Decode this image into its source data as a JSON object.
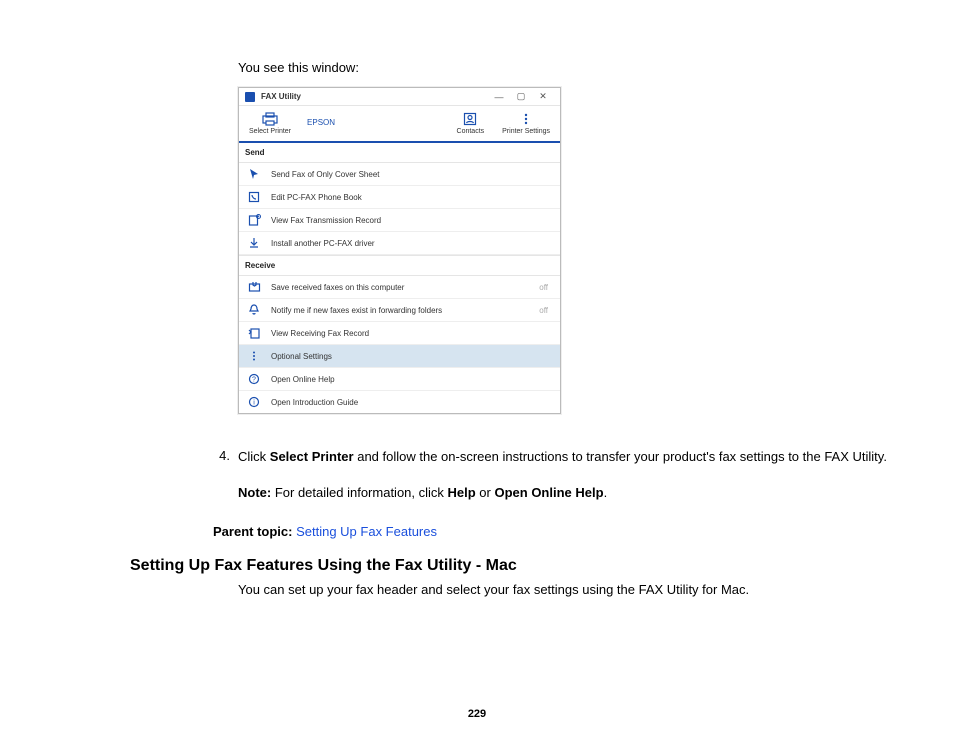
{
  "intro": "You see this window:",
  "window": {
    "title": "FAX Utility",
    "toolbar": {
      "select_printer": "Select Printer",
      "brand": "EPSON",
      "contacts": "Contacts",
      "printer_settings": "Printer Settings"
    },
    "send": {
      "header": "Send",
      "items": [
        "Send Fax of Only Cover Sheet",
        "Edit PC-FAX Phone Book",
        "View Fax Transmission Record",
        "Install another PC-FAX driver"
      ]
    },
    "receive": {
      "header": "Receive",
      "items": [
        {
          "label": "Save received faxes on this computer",
          "status": "off"
        },
        {
          "label": "Notify me if new faxes exist in forwarding folders",
          "status": "off"
        },
        {
          "label": "View Receiving Fax Record",
          "status": ""
        }
      ]
    },
    "footer": {
      "optional_settings": "Optional Settings",
      "online_help": "Open Online Help",
      "intro_guide": "Open Introduction Guide"
    }
  },
  "step": {
    "num": "4.",
    "pre": "Click ",
    "bold1": "Select Printer",
    "mid": " and follow the on-screen instructions to transfer your product's fax settings to the FAX Utility."
  },
  "note": {
    "label": "Note:",
    "pre": " For detailed information, click ",
    "bold1": "Help",
    "mid": " or ",
    "bold2": "Open Online Help",
    "post": "."
  },
  "parent": {
    "label": "Parent topic: ",
    "link": "Setting Up Fax Features"
  },
  "heading": "Setting Up Fax Features Using the Fax Utility - Mac",
  "post_heading": "You can set up your fax header and select your fax settings using the FAX Utility for Mac.",
  "page_number": "229"
}
